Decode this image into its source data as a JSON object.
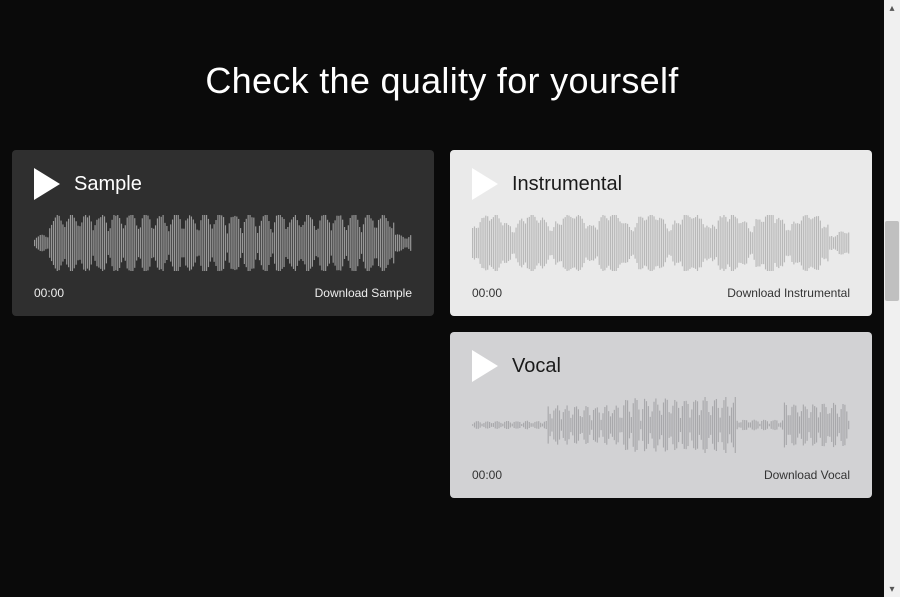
{
  "heading": "Check the quality for yourself",
  "cards": {
    "sample": {
      "title": "Sample",
      "time": "00:00",
      "download": "Download Sample"
    },
    "instrumental": {
      "title": "Instrumental",
      "time": "00:00",
      "download": "Download Instrumental"
    },
    "vocal": {
      "title": "Vocal",
      "time": "00:00",
      "download": "Download Vocal"
    }
  }
}
